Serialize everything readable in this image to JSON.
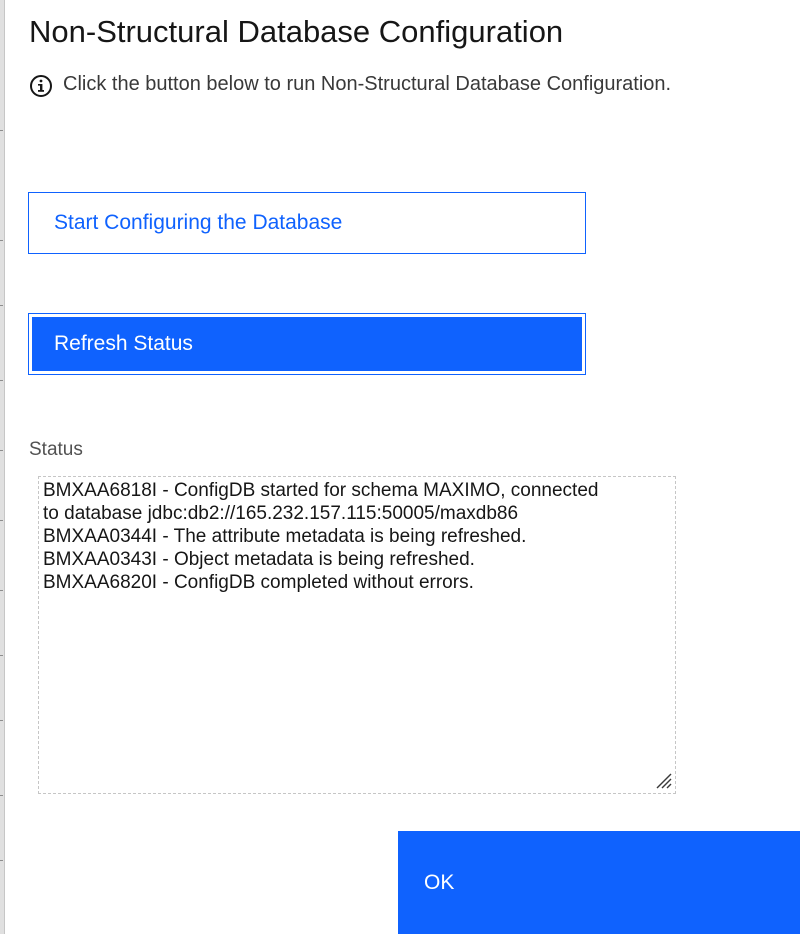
{
  "dialog": {
    "title": "Non-Structural Database Configuration",
    "info_text": "Click the button below to run Non-Structural Database Configuration.",
    "info_icon": "info-icon"
  },
  "buttons": {
    "start_label": "Start Configuring the Database",
    "refresh_label": "Refresh Status",
    "ok_label": "OK"
  },
  "status": {
    "label": "Status",
    "lines": [
      "BMXAA6818I - ConfigDB started for schema MAXIMO, connected",
      "to database jdbc:db2://165.232.157.115:50005/maxdb86",
      "BMXAA0344I - The attribute metadata is being refreshed.",
      "BMXAA0343I - Object metadata is being refreshed.",
      "BMXAA6820I - ConfigDB completed without errors."
    ]
  },
  "colors": {
    "primary": "#0f62fe",
    "text": "#161616",
    "label": "#525252"
  }
}
